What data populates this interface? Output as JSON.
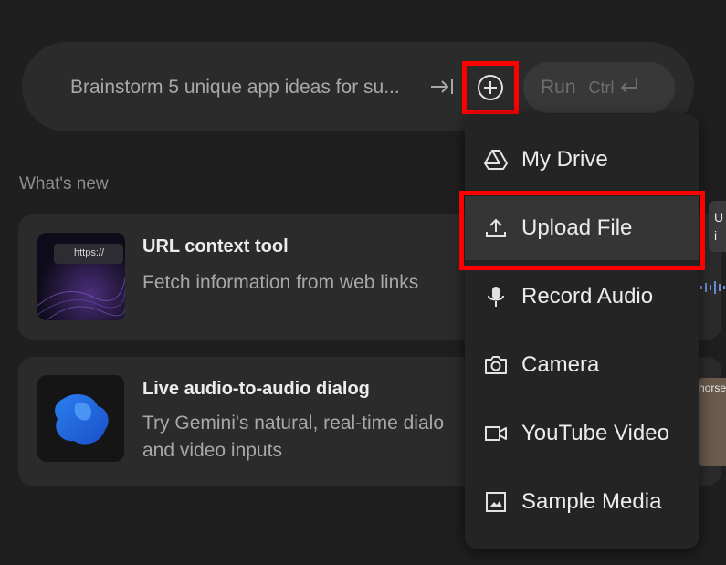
{
  "prompt": {
    "text": "Brainstorm 5 unique app ideas for su...",
    "run_label": "Run",
    "run_shortcut": "Ctrl"
  },
  "whats_new": {
    "heading": "What's new",
    "cards": [
      {
        "title": "URL context tool",
        "description": "Fetch information from web links",
        "thumb_text": "https://"
      },
      {
        "title": "Live audio-to-audio dialog",
        "description_line1": "Try Gemini's natural, real-time dialo",
        "description_line2": "and video inputs"
      }
    ]
  },
  "peek": {
    "tooltip_line1": "U",
    "tooltip_line2": "i",
    "card_text": "horse."
  },
  "menu": {
    "items": [
      {
        "label": "My Drive",
        "icon": "drive-icon"
      },
      {
        "label": "Upload File",
        "icon": "upload-icon"
      },
      {
        "label": "Record Audio",
        "icon": "microphone-icon"
      },
      {
        "label": "Camera",
        "icon": "camera-icon"
      },
      {
        "label": "YouTube Video",
        "icon": "video-icon"
      },
      {
        "label": "Sample Media",
        "icon": "image-icon"
      }
    ]
  },
  "colors": {
    "background": "#1f1f1f",
    "surface": "#2b2b2b",
    "menu": "#242424",
    "highlight_border": "#ff0000"
  }
}
